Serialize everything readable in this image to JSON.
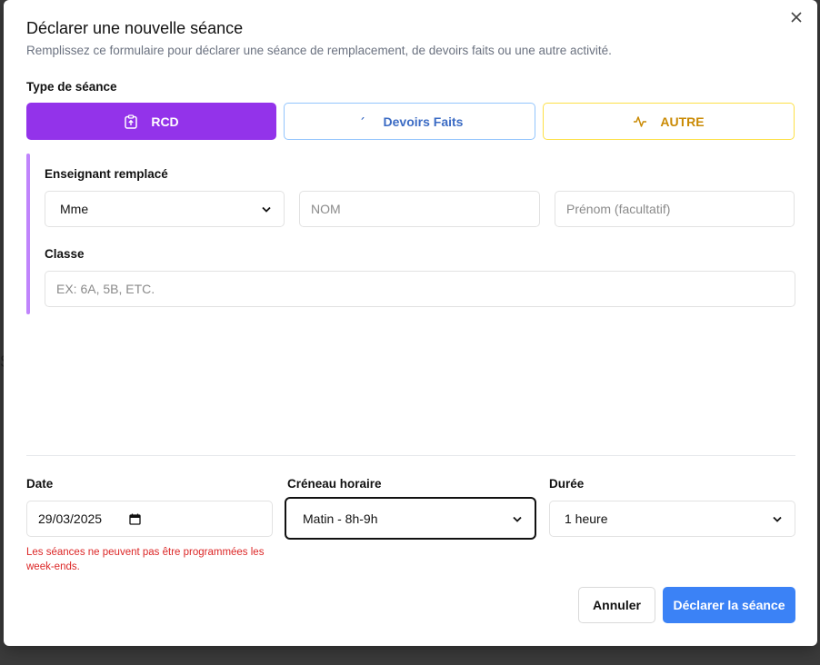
{
  "dialog": {
    "title": "Déclarer une nouvelle séance",
    "subtitle": "Remplissez ce formulaire pour déclarer une séance de remplacement, de devoirs faits ou une autre activité.",
    "close_icon": "close-icon"
  },
  "session_type": {
    "label": "Type de séance",
    "options": [
      {
        "label": "RCD",
        "icon": "clipboard-upload-icon",
        "selected": true,
        "color": "#9333ea"
      },
      {
        "label": "Devoirs Faits",
        "icon": "chevron-right-icon",
        "selected": false,
        "color": "#3b6bc4"
      },
      {
        "label": "AUTRE",
        "icon": "activity-icon",
        "selected": false,
        "color": "#ca8a04"
      }
    ]
  },
  "replaced_teacher": {
    "label": "Enseignant remplacé",
    "civility_value": "Mme",
    "name_placeholder": "NOM",
    "firstname_placeholder": "Prénom (facultatif)"
  },
  "class_field": {
    "label": "Classe",
    "placeholder": "EX: 6A, 5B, ETC."
  },
  "date": {
    "label": "Date",
    "value": "29/03/2025",
    "error": "Les séances ne peuvent pas être programmées les week-ends."
  },
  "slot": {
    "label": "Créneau horaire",
    "value": "Matin - 8h-9h"
  },
  "duration": {
    "label": "Durée",
    "value": "1 heure"
  },
  "actions": {
    "cancel_label": "Annuler",
    "submit_label": "Déclarer la séance",
    "submit_color": "#3b82f6"
  }
}
